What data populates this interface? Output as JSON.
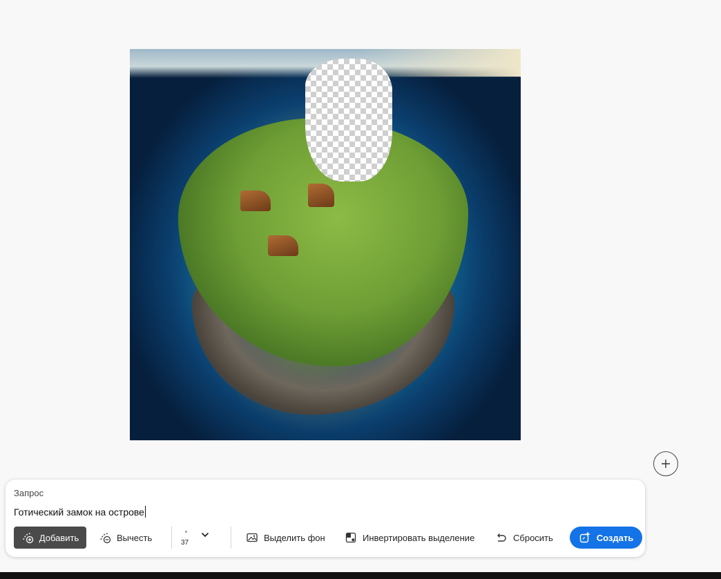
{
  "canvas": {
    "image_alt": "Island artwork with transparent masked region"
  },
  "prompt": {
    "label": "Запрос",
    "value": "Готический замок на острове"
  },
  "toolbar": {
    "add_label": "Добавить",
    "subtract_label": "Вычесть",
    "brush_size": "37",
    "select_bg_label": "Выделить фон",
    "invert_label": "Инвертировать выделение",
    "reset_label": "Сбросить",
    "create_label": "Создать"
  },
  "colors": {
    "accent": "#1473e6",
    "active_tool": "#4a4a4a"
  }
}
